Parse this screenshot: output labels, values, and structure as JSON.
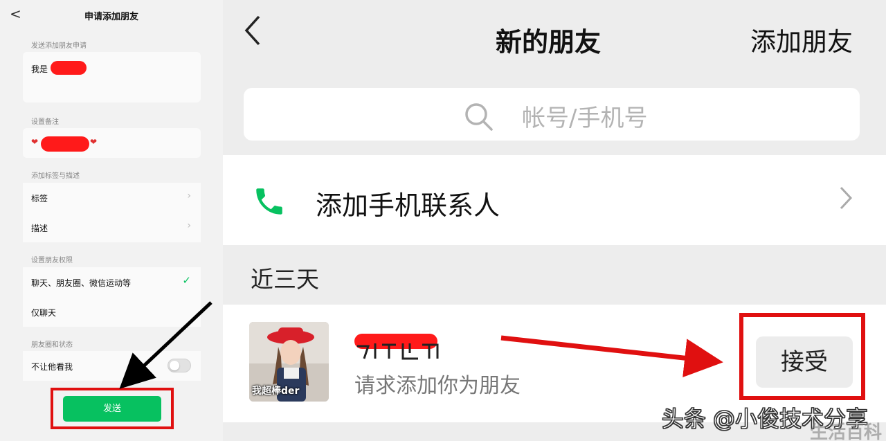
{
  "left_panel": {
    "title": "申请添加朋友",
    "back_glyph": "<",
    "section_request": "发送添加朋友申请",
    "request_prefix": "我是",
    "section_remark": "设置备注",
    "section_tags": "添加标签与描述",
    "tags_label": "标签",
    "desc_label": "描述",
    "section_permission": "设置朋友权限",
    "perm_option_all": "聊天、朋友圈、微信运动等",
    "perm_option_chat": "仅聊天",
    "section_moments": "朋友圈和状态",
    "hide_my_moments": "不让他看我",
    "send_button": "发送",
    "colors": {
      "accent": "#07c160",
      "highlight": "#e01010"
    }
  },
  "right_panel": {
    "back_glyph": "<",
    "title": "新的朋友",
    "add_friend": "添加朋友",
    "search_placeholder": "帐号/手机号",
    "add_phone_contacts": "添加手机联系人",
    "recent_header": "近三天",
    "request_subtitle": "请求添加你为朋友",
    "avatar_caption": "我超棒der",
    "accept_button": "接受",
    "colors": {
      "phone_icon": "#07c160",
      "highlight": "#e01010"
    }
  },
  "watermark": "头条 @小俊技术分享",
  "corner_mark": "生活百科"
}
